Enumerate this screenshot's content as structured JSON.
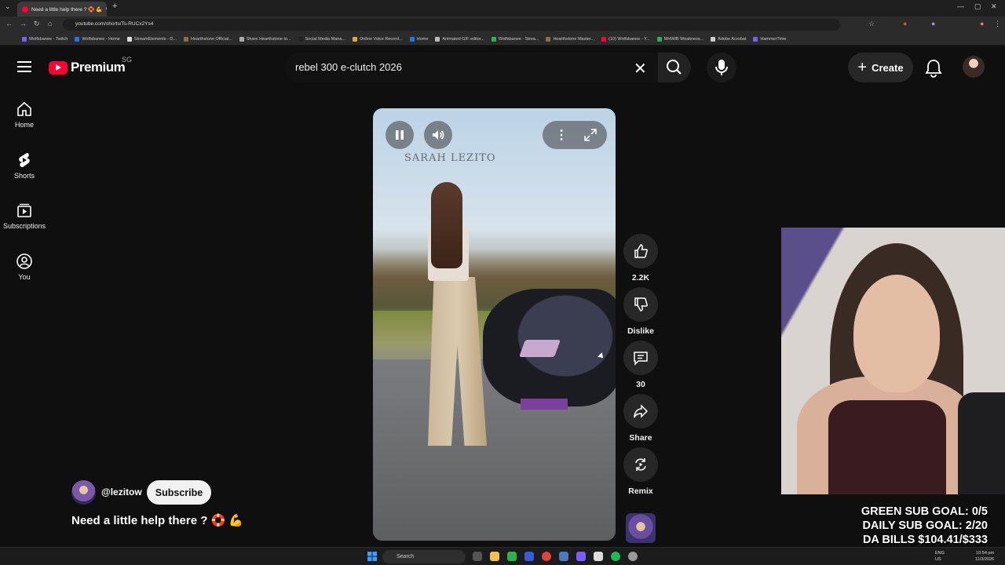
{
  "browser": {
    "tab_title": "Need a little help there ? 🛟 💪",
    "url": "youtube.com/shorts/Ts-RUCx2Ys4",
    "bookmarks": [
      "Wolfsbanee - Twitch",
      "Wolfsbanee - Home",
      "StreamElements - D...",
      "Hearthstone Official...",
      "Share Hearthstone to...",
      "Social Media Mana...",
      "Online Voice Record...",
      "Home",
      "Animated GIF editor...",
      "Wolfsbanee - Strea...",
      "Hearthstone Master...",
      "(10) Wolfsbanee - Y...",
      "MHWIB Weakness...",
      "Adobe Acrobat",
      "HammerTime"
    ]
  },
  "header": {
    "logo_text": "Premium",
    "region": "SG",
    "search_value": "rebel 300 e-clutch 2026",
    "create_label": "Create"
  },
  "sidebar": {
    "items": [
      {
        "label": "Home",
        "icon": "home-icon"
      },
      {
        "label": "Shorts",
        "icon": "shorts-icon"
      },
      {
        "label": "Subscriptions",
        "icon": "subscriptions-icon"
      },
      {
        "label": "You",
        "icon": "you-icon"
      }
    ]
  },
  "player": {
    "watermark": "SARAH LEZITO"
  },
  "actions": {
    "likes": "2.2K",
    "dislike_label": "Dislike",
    "comments": "30",
    "share_label": "Share",
    "remix_label": "Remix"
  },
  "video": {
    "channel": "@lezitow",
    "subscribe_label": "Subscribe",
    "title": "Need a little help there ? 🛟 💪"
  },
  "overlay": {
    "green_goal": "GREEN SUB GOAL: 0/5",
    "daily_goal": "DAILY SUB GOAL: 2/20",
    "bills": "DA BILLS $104.41/$333"
  },
  "taskbar": {
    "search_label": "Search",
    "lang_top": "ENG",
    "lang_bottom": "US",
    "time": "10:54 pm",
    "date": "11/3/2026"
  },
  "colors": {
    "brand": "#ff0033",
    "background": "#0f0f0f",
    "button_bg": "#272727"
  }
}
